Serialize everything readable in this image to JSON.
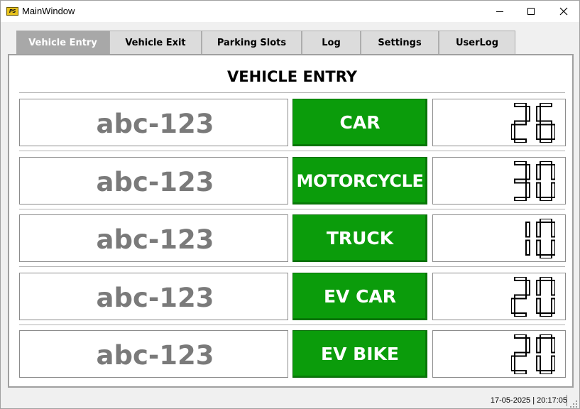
{
  "window": {
    "title": "MainWindow",
    "icon_label": "PS",
    "controls": {
      "minimize": "minimize-icon",
      "maximize": "maximize-icon",
      "close": "close-icon"
    }
  },
  "tabs": [
    {
      "label": "Vehicle Entry",
      "active": true
    },
    {
      "label": "Vehicle Exit",
      "active": false
    },
    {
      "label": "Parking Slots",
      "active": false
    },
    {
      "label": "Log",
      "active": false
    },
    {
      "label": "Settings",
      "active": false
    },
    {
      "label": "UserLog",
      "active": false
    }
  ],
  "page": {
    "title": "VEHICLE ENTRY"
  },
  "rows": [
    {
      "plate": "abc-123",
      "type": "CAR",
      "count": "26"
    },
    {
      "plate": "abc-123",
      "type": "MOTORCYCLE",
      "count": "30"
    },
    {
      "plate": "abc-123",
      "type": "TRUCK",
      "count": "10"
    },
    {
      "plate": "abc-123",
      "type": "EV CAR",
      "count": "20"
    },
    {
      "plate": "abc-123",
      "type": "EV BIKE",
      "count": "20"
    }
  ],
  "status": {
    "date": "17-05-2025",
    "separator": " | ",
    "time": "20:17:05"
  },
  "colors": {
    "button_green": "#0b9c0b",
    "active_tab": "#a8a8a8",
    "plate_text": "#7a7a7a"
  }
}
